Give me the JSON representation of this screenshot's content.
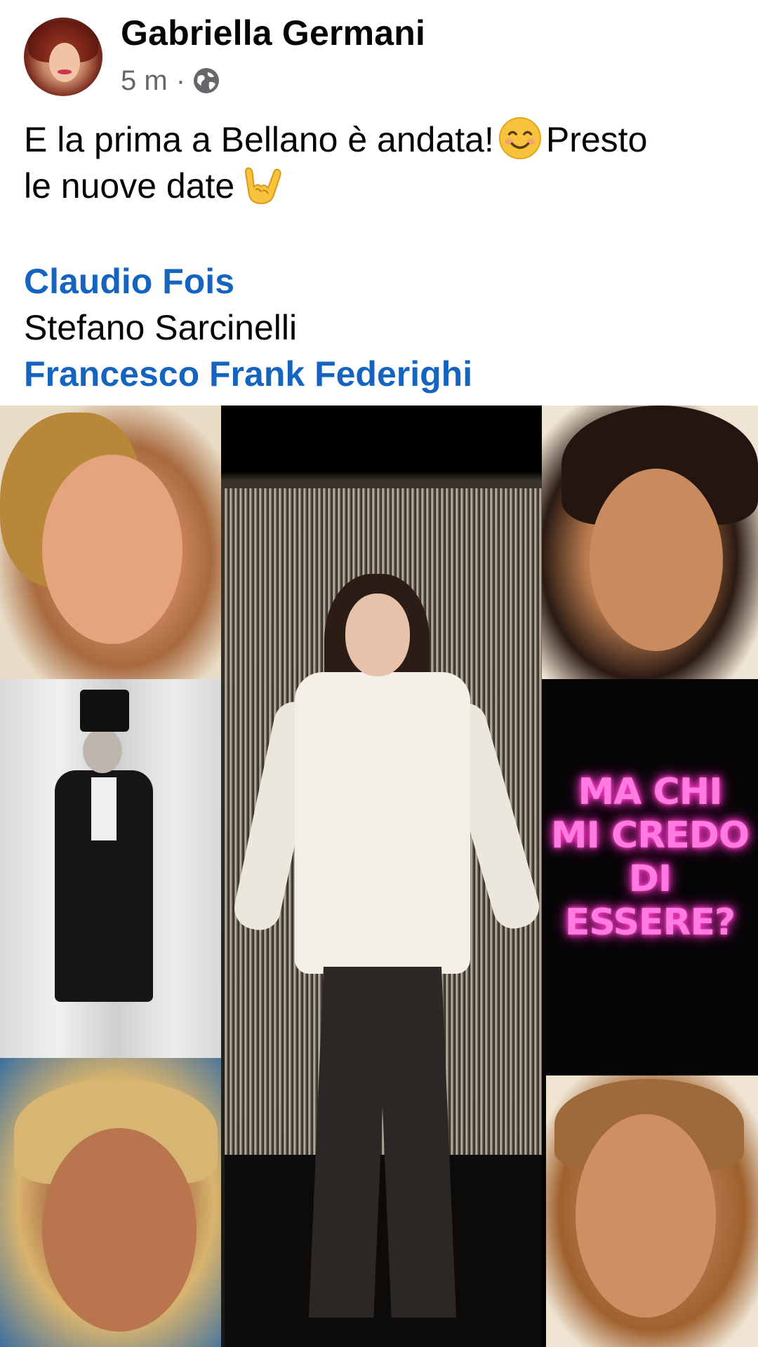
{
  "post": {
    "author": "Gabriella Germani",
    "timestamp": "5 m",
    "separator": "·",
    "audience_icon": "globe-icon",
    "text_line1": "E la prima a Bellano è andata!",
    "text_line1_end": "Presto",
    "text_line2": "le nuove date",
    "emoji1": "smiling-face-icon",
    "emoji2": "rock-on-hand-icon",
    "tags": [
      {
        "name": "Claudio Fois",
        "linked": true
      },
      {
        "name": "Stefano Sarcinelli",
        "linked": false
      },
      {
        "name": "Francesco Frank Federighi",
        "linked": true
      }
    ]
  },
  "photo": {
    "overlay_text": [
      "MA CHI",
      "MI CREDO",
      "DI",
      "ESSERE?"
    ],
    "overlay_color": "#ff7be0"
  },
  "colors": {
    "link": "#1565c0",
    "text": "#050505",
    "meta": "#65676b"
  }
}
